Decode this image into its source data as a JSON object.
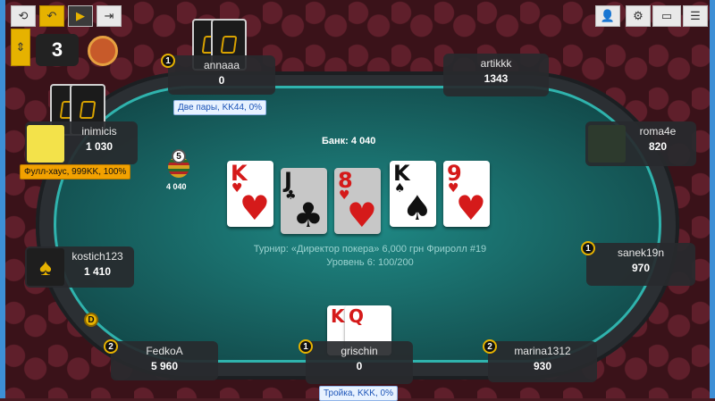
{
  "toolbar": {
    "history_icon": "history-icon",
    "back_icon": "undo-icon",
    "play_icon": "play-icon",
    "exit_icon": "exit-icon",
    "add_user_icon": "add-user-icon",
    "settings_icon": "gear-icon",
    "view_icon": "window-icon",
    "menu_icon": "menu-icon"
  },
  "pot": {
    "label": "Банк: 4 040",
    "chips_value": "4 040",
    "chip_number": "5"
  },
  "tournament": {
    "line1": "Турнир: «Директор покера» 6,000 грн Фриролл #19",
    "line2": "Уровень 6: 100/200"
  },
  "board": [
    {
      "rank": "K",
      "suit": "♥",
      "color": "red",
      "dim": false
    },
    {
      "rank": "J",
      "suit": "♣",
      "color": "blk",
      "dim": true
    },
    {
      "rank": "8",
      "suit": "♥",
      "color": "red",
      "dim": true
    },
    {
      "rank": "K",
      "suit": "♠",
      "color": "blk",
      "dim": false
    },
    {
      "rank": "9",
      "suit": "♥",
      "color": "red",
      "dim": false
    }
  ],
  "players": {
    "annaaa": {
      "name": "annaaa",
      "stack": "0",
      "badge": "1",
      "hand": "Две пары, KK44, 0%"
    },
    "artikkk": {
      "name": "artikkk",
      "stack": "1343"
    },
    "inimicis": {
      "name": "inimicis",
      "stack": "1 030",
      "hand": "Фулл-хаус, 999KK, 100%"
    },
    "roma4e": {
      "name": "roma4e",
      "stack": "820"
    },
    "kostich123": {
      "name": "kostich123",
      "stack": "1 410"
    },
    "sanek19n": {
      "name": "sanek19n",
      "stack": "970",
      "badge": "1"
    },
    "fedkoa": {
      "name": "FedkoA",
      "stack": "5 960",
      "badge": "2"
    },
    "grischin": {
      "name": "grischin",
      "stack": "0",
      "badge": "1",
      "hand": "Тройка, KKK, 0%",
      "cards": [
        {
          "rank": "K",
          "color": "red"
        },
        {
          "rank": "Q",
          "color": "red"
        }
      ]
    },
    "marina": {
      "name": "marina1312",
      "stack": "930",
      "badge": "2"
    }
  },
  "dealer_label": "D"
}
